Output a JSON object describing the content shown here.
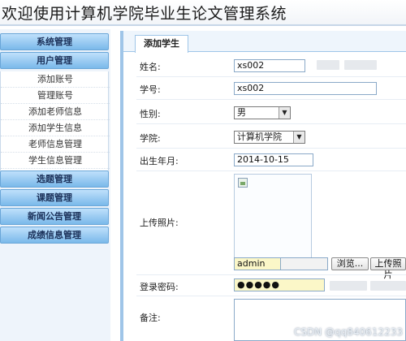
{
  "app": {
    "title": "欢迎使用计算机学院毕业生论文管理系统"
  },
  "sidebar": {
    "menus": [
      {
        "label": "系统管理"
      },
      {
        "label": "用户管理"
      }
    ],
    "submenu": [
      {
        "label": "添加账号"
      },
      {
        "label": "管理账号"
      },
      {
        "label": "添加老师信息"
      },
      {
        "label": "添加学生信息"
      },
      {
        "label": "老师信息管理"
      },
      {
        "label": "学生信息管理"
      }
    ],
    "menus_after": [
      {
        "label": "选题管理"
      },
      {
        "label": "课题管理"
      },
      {
        "label": "新闻公告管理"
      },
      {
        "label": "成绩信息管理"
      }
    ]
  },
  "tab": {
    "label": "添加学生"
  },
  "form": {
    "name": {
      "label": "姓名:",
      "value": "xs002"
    },
    "student_id": {
      "label": "学号:",
      "value": "xs002"
    },
    "gender": {
      "label": "性别:",
      "value": "男"
    },
    "college": {
      "label": "学院:",
      "value": "计算机学院"
    },
    "birth": {
      "label": "出生年月:",
      "value": "2014-10-15"
    },
    "photo": {
      "label": "上传照片:",
      "file_value": "admin",
      "browse_label": "浏览...",
      "upload_label": "上传照片"
    },
    "password": {
      "label": "登录密码:",
      "value": "●●●●●"
    },
    "notes": {
      "label": "备注:"
    }
  },
  "watermark": "CSDN @qq840612233",
  "icons": {
    "photo_placeholder": "image-icon",
    "dropdown": "chevron-down-icon"
  }
}
